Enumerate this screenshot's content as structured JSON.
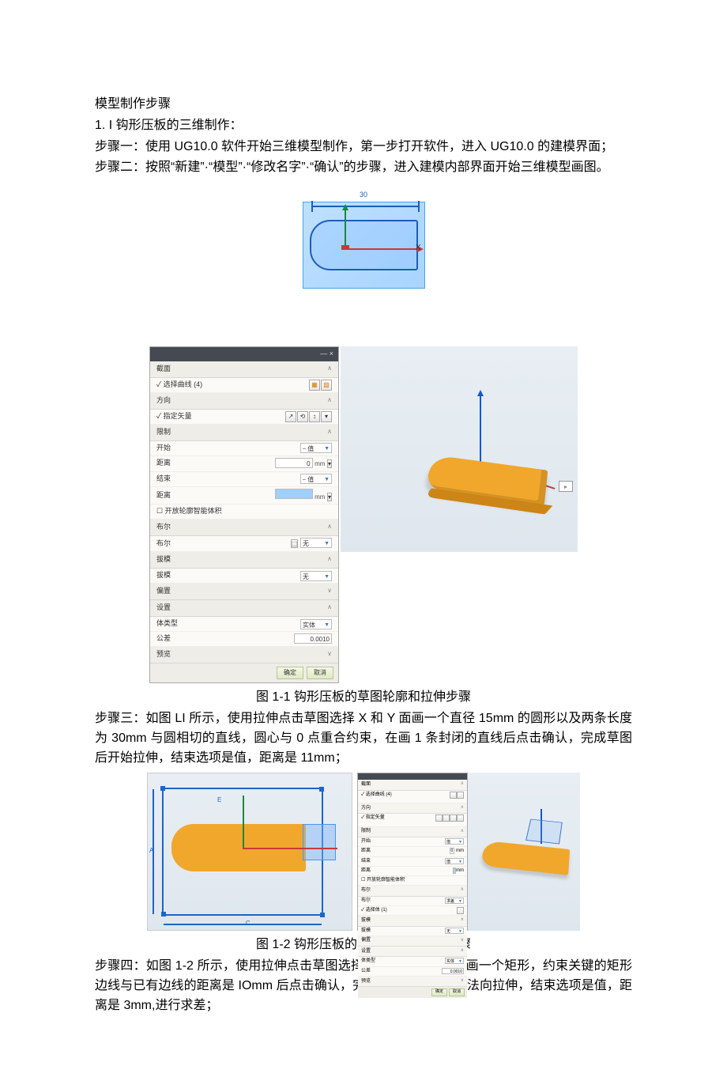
{
  "heading": "模型制作步骤",
  "line1": "1. I 钩形压板的三维制作：",
  "step1": "步骤一：使用 UG10.0 软件开始三维模型制作，第一步打开软件，进入 UG10.0 的建模界面；",
  "step2": "步骤二：按照“新建”·“模型”·“修改名字”·“确认”的步骤，进入建模内部界面开始三维模型画图。",
  "sketch1_dim": "30",
  "sketch1_x": "X",
  "dialog": {
    "title_icons": "— ×",
    "sections": {
      "s0": "截面",
      "s0a": "✓ 选择曲线 (4)",
      "s1": "方向",
      "s1a": "✓ 指定矢量",
      "s2": "限制",
      "r_start": "开始",
      "r_start_v": "⎯ 值",
      "r_dist1": "距离",
      "r_dist1_v": "0",
      "r_dist1_u": "mm",
      "r_end": "结束",
      "r_end_v": "⎯ 值",
      "r_dist2": "距离",
      "r_dist2_v": "",
      "r_dist2_u": "mm",
      "chk": "开放轮廓智能体积",
      "s3": "布尔",
      "r_bool": "布尔",
      "r_bool_v": "无",
      "s4": "拔模",
      "r_draft": "拔模",
      "r_draft_v": "无",
      "s5": "偏置",
      "s6": "设置",
      "r_type": "体类型",
      "r_type_v": "实体",
      "r_tol": "公差",
      "r_tol_v": "0.0010",
      "s7": "预览",
      "btn_ok": "确定",
      "btn_cancel": "取消"
    },
    "view_btn": "▸"
  },
  "caption1": "图 1-1 钩形压板的草图轮廓和拉伸步骤",
  "step3": "步骤三：如图 LI 所示，使用拉伸点击草图选择 X 和 Y 面画一个直径 15mm 的圆形以及两条长度为 30mm 与圆相切的直线，圆心与 0 点重合约束，在画 1 条封闭的直线后点击确认，完成草图后开始拉伸，结束选项是值，距离是 11mm；",
  "fig3_labels": {
    "a": "A",
    "c": "C",
    "e": "E"
  },
  "mini": {
    "s0": "截面",
    "s0a": "✓ 选择曲线 (4)",
    "s1": "方向",
    "s1a": "✓ 指定矢量",
    "s2": "限制",
    "start": "开始",
    "dist": "距离",
    "end": "结束",
    "dist_u": "mm",
    "chk": "开放轮廓智能体积",
    "s3": "布尔",
    "bool": "布尔",
    "bool_v": "求差",
    "s3b": "✓ 选择体 (1)",
    "s4": "拔模",
    "draft": "拔模",
    "draft_v": "无",
    "s5": "偏置",
    "s6": "设置",
    "type": "体类型",
    "type_v": "实体",
    "tol": "公差",
    "tol_v": "0.0010",
    "s7": "预览",
    "ok": "确定",
    "cancel": "取消"
  },
  "caption2": "图 1-2 钩形压板的草图轮廓和拉伸步骤",
  "step4": "步骤四：如图 1-2 所示，使用拉伸点击草图选择第一个拉伸的面上画一个矩形，约束关键的矩形边线与已有边线的距离是 IOmm 后点击确认，完成草图后开始沿面法向拉伸，结束选项是值，距离是 3mm,进行求差；"
}
